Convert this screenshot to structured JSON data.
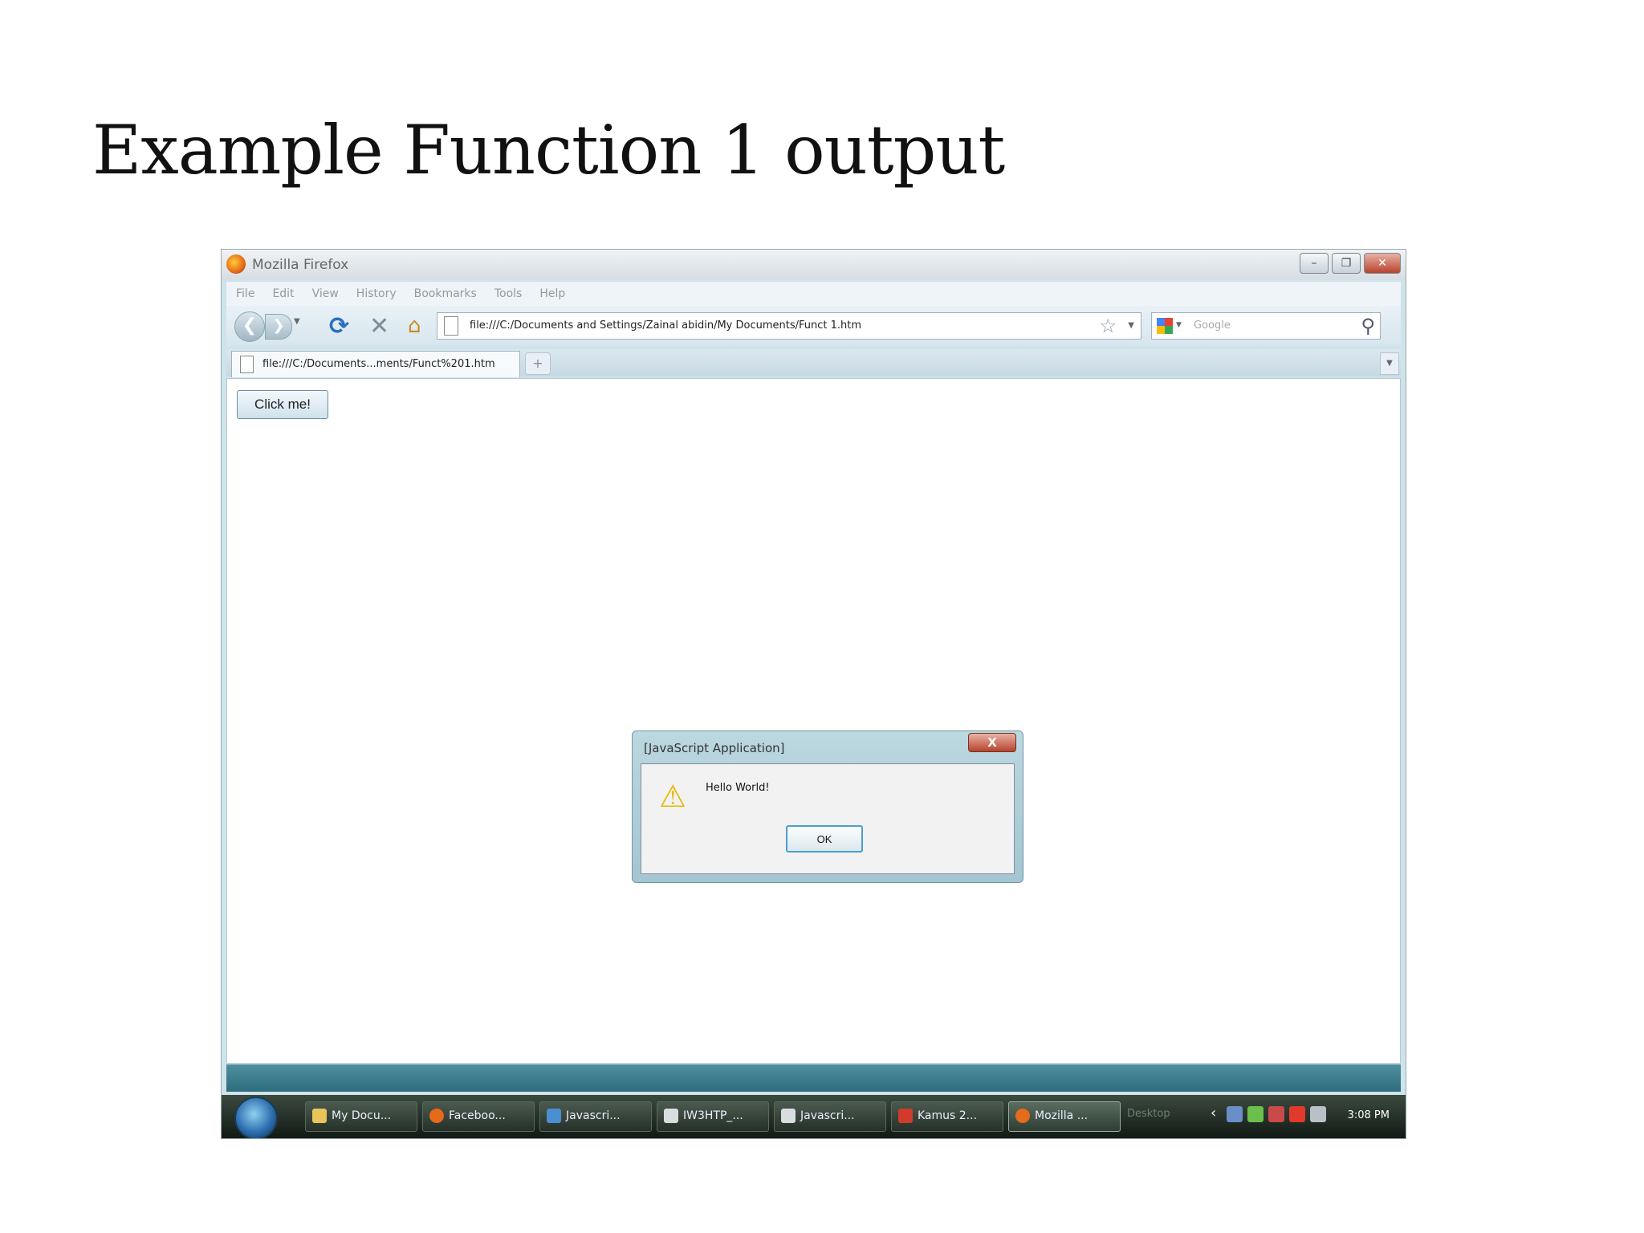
{
  "slide": {
    "title": "Example Function 1 output"
  },
  "window": {
    "title": "Mozilla Firefox",
    "menu": [
      "File",
      "Edit",
      "View",
      "History",
      "Bookmarks",
      "Tools",
      "Help"
    ],
    "url": "file:///C:/Documents and Settings/Zainal abidin/My Documents/Funct 1.htm",
    "search_placeholder": "Google",
    "tab_label": "file:///C:/Documents...ments/Funct%201.htm",
    "newtab_glyph": "+"
  },
  "page": {
    "button_label": "Click me!"
  },
  "dialog": {
    "title": "[JavaScript Application]",
    "close_glyph": "X",
    "message": "Hello World!",
    "ok_label": "OK"
  },
  "taskbar": {
    "items": [
      "My Docu...",
      "Faceboo...",
      "Javascri...",
      "IW3HTP_...",
      "Javascri...",
      "Kamus 2...",
      "Mozilla ..."
    ],
    "desktop_label": "Desktop",
    "clock": "3:08 PM"
  },
  "colors": {
    "accent": "#2e6c7e",
    "close_red": "#b7432d",
    "ok_focus": "#4a9fd0"
  },
  "icons": [
    "firefox-icon",
    "back-icon",
    "forward-icon",
    "reload-icon",
    "stop-icon",
    "home-icon",
    "page-icon",
    "star-icon",
    "google-icon",
    "magnifier-icon",
    "warning-icon",
    "start-orb-icon"
  ]
}
